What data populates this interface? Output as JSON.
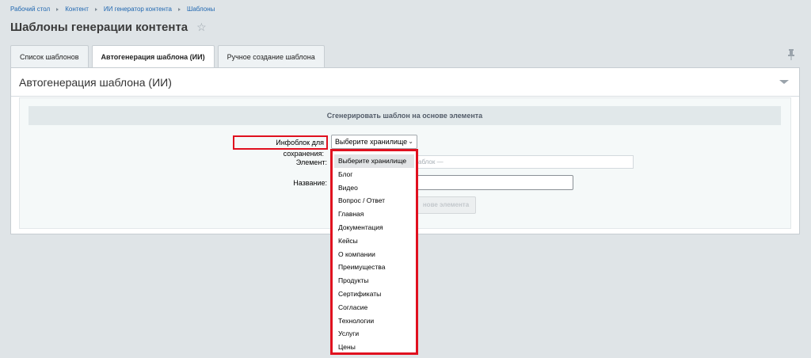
{
  "breadcrumb": [
    "Рабочий стол",
    "Контент",
    "ИИ генератор контента",
    "Шаблоны"
  ],
  "page_title": "Шаблоны генерации контента",
  "tabs": [
    "Список шаблонов",
    "Автогенерация шаблона (ИИ)",
    "Ручное создание шаблона"
  ],
  "panel": {
    "title": "Автогенерация шаблона (ИИ)",
    "section_header": "Сгенерировать шаблон на основе элемента"
  },
  "form": {
    "infoblock_label": "Инфоблок для сохранения:",
    "infoblock_value": "Выберите хранилище",
    "element_label": "Элемент:",
    "element_placeholder": "аблок —",
    "name_label": "Название:",
    "name_value": "",
    "generate_button": "нове элемента"
  },
  "dropdown_options": [
    "Выберите хранилище",
    "Блог",
    "Видео",
    "Вопрос / Ответ",
    "Главная",
    "Документация",
    "Кейсы",
    "О компании",
    "Преимущества",
    "Продукты",
    "Сертификаты",
    "Согласие",
    "Технологии",
    "Услуги",
    "Цены"
  ],
  "icons": {
    "star": "star-icon",
    "pin": "pin-icon",
    "collapse": "chevron-down-icon"
  },
  "colors": {
    "highlight": "#e0101f",
    "link": "#2067b0",
    "background": "#dfe4e7"
  }
}
